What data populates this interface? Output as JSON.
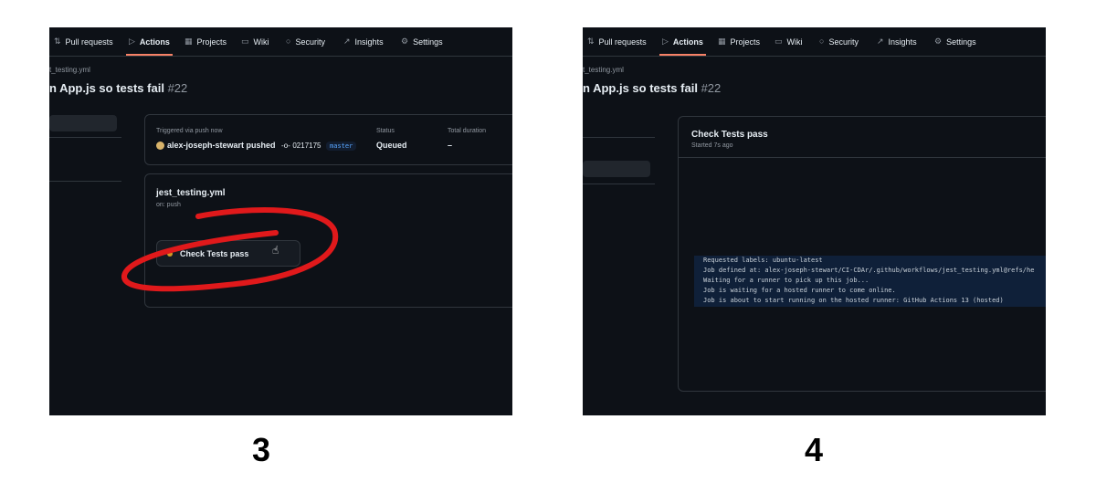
{
  "nav": {
    "tabs": [
      {
        "label": "Pull requests",
        "icon": "pull-request-icon",
        "glyph": "⇅",
        "active": false
      },
      {
        "label": "Actions",
        "icon": "play-icon",
        "glyph": "▷",
        "active": true
      },
      {
        "label": "Projects",
        "icon": "table-icon",
        "glyph": "▦",
        "active": false
      },
      {
        "label": "Wiki",
        "icon": "book-icon",
        "glyph": "▭",
        "active": false
      },
      {
        "label": "Security",
        "icon": "shield-icon",
        "glyph": "○",
        "active": false
      },
      {
        "label": "Insights",
        "icon": "graph-icon",
        "glyph": "↗",
        "active": false
      },
      {
        "label": "Settings",
        "icon": "gear-icon",
        "glyph": "⚙",
        "active": false
      }
    ]
  },
  "step3": {
    "caption": "3",
    "file_crumb": "t_testing.yml",
    "run_title": "n App.js so tests fail",
    "run_number": "#22",
    "summary": {
      "trigger_label": "Triggered via push now",
      "author": "alex-joseph-stewart pushed",
      "commit_icon": "commit-icon",
      "sha": "0217175",
      "branch": "master",
      "status_label": "Status",
      "status_value": "Queued",
      "duration_label": "Total duration",
      "duration_value": "–"
    },
    "workflow": {
      "name": "jest_testing.yml",
      "trigger": "on: push",
      "job_label": "Check Tests pass",
      "job_status_color": "#d29922"
    },
    "annotation_color": "#e0191b"
  },
  "step4": {
    "caption": "4",
    "file_crumb": "t_testing.yml",
    "run_title": "n App.js so tests fail",
    "run_number": "#22",
    "job": {
      "title": "Check Tests pass",
      "started": "Started 7s ago",
      "log_lines": [
        "Requested labels: ubuntu-latest",
        "Job defined at: alex-joseph-stewart/CI-CDAr/.github/workflows/jest_testing.yml@refs/he",
        "Waiting for a runner to pick up this job...",
        "Job is waiting for a hosted runner to come online.",
        "Job is about to start running on the hosted runner: GitHub Actions 13 (hosted)"
      ]
    }
  },
  "colors": {
    "background": "#0d1117",
    "border": "#30363d",
    "active_tab_underline": "#f78166",
    "branch_text": "#58a6ff",
    "log_highlight": "#0f2039"
  }
}
